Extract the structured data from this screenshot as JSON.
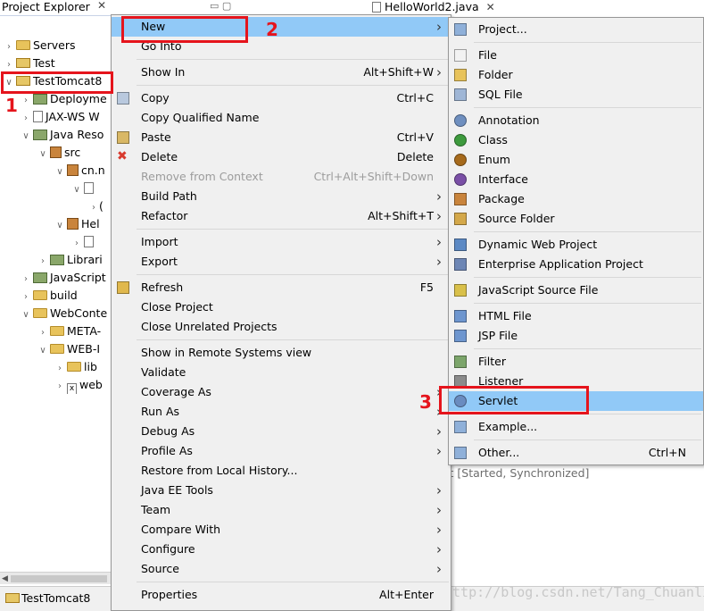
{
  "explorer": {
    "title": "Project Explorer",
    "close_glyph": "✕",
    "tree": [
      {
        "label": "Servers",
        "icon": "folder-icon",
        "depth": 1,
        "expanded": false
      },
      {
        "label": "Test",
        "icon": "project-icon",
        "depth": 1,
        "expanded": false
      },
      {
        "label": "TestTomcat8",
        "icon": "project-icon",
        "depth": 1,
        "expanded": true
      },
      {
        "label": "Deployme",
        "icon": "descriptor-icon",
        "depth": 2,
        "expanded": false
      },
      {
        "label": "JAX-WS W",
        "icon": "webservice-icon",
        "depth": 2,
        "expanded": false
      },
      {
        "label": "Java Reso",
        "icon": "java-resources-icon",
        "depth": 2,
        "expanded": true
      },
      {
        "label": "src",
        "icon": "source-folder-icon",
        "depth": 3,
        "expanded": true
      },
      {
        "label": "cn.n",
        "icon": "package-icon",
        "depth": 4,
        "expanded": true
      },
      {
        "label": "",
        "icon": "java-file-icon",
        "depth": 5,
        "expanded": true
      },
      {
        "label": "(",
        "icon": "",
        "depth": 6,
        "expanded": false
      },
      {
        "label": "Hel",
        "icon": "package-icon",
        "depth": 4,
        "expanded": true
      },
      {
        "label": "",
        "icon": "java-file-icon",
        "depth": 5,
        "expanded": false
      },
      {
        "label": "Librari",
        "icon": "library-icon",
        "depth": 3,
        "expanded": false
      },
      {
        "label": "JavaScript",
        "icon": "javascript-icon",
        "depth": 2,
        "expanded": false
      },
      {
        "label": "build",
        "icon": "folder-icon",
        "depth": 2,
        "expanded": false
      },
      {
        "label": "WebConte",
        "icon": "folder-icon",
        "depth": 2,
        "expanded": true
      },
      {
        "label": "META-",
        "icon": "folder-icon",
        "depth": 3,
        "expanded": false
      },
      {
        "label": "WEB-I",
        "icon": "folder-icon",
        "depth": 3,
        "expanded": true
      },
      {
        "label": "lib",
        "icon": "folder-icon",
        "depth": 4,
        "expanded": false
      },
      {
        "label": "web",
        "icon": "xml-file-icon",
        "depth": 4,
        "expanded": false
      }
    ]
  },
  "status_bar": {
    "text": "TestTomcat8"
  },
  "editor": {
    "tab_label": "HelloWorld2.java",
    "tab_close": "✕",
    "min_max": "▭ ▢",
    "server_status": "st  [Started, Synchronized]"
  },
  "context_menu": {
    "items": [
      {
        "label": "New",
        "shortcut": "",
        "submenu": true,
        "icon": "",
        "highlight": true
      },
      {
        "label": "Go Into",
        "shortcut": "",
        "submenu": false,
        "icon": ""
      },
      {
        "sep": true
      },
      {
        "label": "Show In",
        "shortcut": "Alt+Shift+W",
        "submenu": true,
        "icon": ""
      },
      {
        "sep": true
      },
      {
        "label": "Copy",
        "shortcut": "Ctrl+C",
        "submenu": false,
        "icon": "copy-icon"
      },
      {
        "label": "Copy Qualified Name",
        "shortcut": "",
        "submenu": false,
        "icon": ""
      },
      {
        "label": "Paste",
        "shortcut": "Ctrl+V",
        "submenu": false,
        "icon": "paste-icon"
      },
      {
        "label": "Delete",
        "shortcut": "Delete",
        "submenu": false,
        "icon": "delete-icon"
      },
      {
        "label": "Remove from Context",
        "shortcut": "Ctrl+Alt+Shift+Down",
        "submenu": false,
        "icon": "",
        "disabled": true
      },
      {
        "label": "Build Path",
        "shortcut": "",
        "submenu": true,
        "icon": ""
      },
      {
        "label": "Refactor",
        "shortcut": "Alt+Shift+T",
        "submenu": true,
        "icon": ""
      },
      {
        "sep": true
      },
      {
        "label": "Import",
        "shortcut": "",
        "submenu": true,
        "icon": ""
      },
      {
        "label": "Export",
        "shortcut": "",
        "submenu": true,
        "icon": ""
      },
      {
        "sep": true
      },
      {
        "label": "Refresh",
        "shortcut": "F5",
        "submenu": false,
        "icon": "refresh-icon"
      },
      {
        "label": "Close Project",
        "shortcut": "",
        "submenu": false,
        "icon": ""
      },
      {
        "label": "Close Unrelated Projects",
        "shortcut": "",
        "submenu": false,
        "icon": ""
      },
      {
        "sep": true
      },
      {
        "label": "Show in Remote Systems view",
        "shortcut": "",
        "submenu": false,
        "icon": ""
      },
      {
        "label": "Validate",
        "shortcut": "",
        "submenu": false,
        "icon": ""
      },
      {
        "label": "Coverage As",
        "shortcut": "",
        "submenu": true,
        "icon": ""
      },
      {
        "label": "Run As",
        "shortcut": "",
        "submenu": true,
        "icon": ""
      },
      {
        "label": "Debug As",
        "shortcut": "",
        "submenu": true,
        "icon": ""
      },
      {
        "label": "Profile As",
        "shortcut": "",
        "submenu": true,
        "icon": ""
      },
      {
        "label": "Restore from Local History...",
        "shortcut": "",
        "submenu": false,
        "icon": ""
      },
      {
        "label": "Java EE Tools",
        "shortcut": "",
        "submenu": true,
        "icon": ""
      },
      {
        "label": "Team",
        "shortcut": "",
        "submenu": true,
        "icon": ""
      },
      {
        "label": "Compare With",
        "shortcut": "",
        "submenu": true,
        "icon": ""
      },
      {
        "label": "Configure",
        "shortcut": "",
        "submenu": true,
        "icon": ""
      },
      {
        "label": "Source",
        "shortcut": "",
        "submenu": true,
        "icon": ""
      },
      {
        "sep": true
      },
      {
        "label": "Properties",
        "shortcut": "Alt+Enter",
        "submenu": false,
        "icon": ""
      }
    ]
  },
  "new_submenu": {
    "items": [
      {
        "label": "Project...",
        "shortcut": "",
        "icon": "new-project-icon"
      },
      {
        "sep": true
      },
      {
        "label": "File",
        "shortcut": "",
        "icon": "new-file-icon"
      },
      {
        "label": "Folder",
        "shortcut": "",
        "icon": "new-folder-icon"
      },
      {
        "label": "SQL File",
        "shortcut": "",
        "icon": "sql-file-icon"
      },
      {
        "sep": true
      },
      {
        "label": "Annotation",
        "shortcut": "",
        "icon": "annotation-icon"
      },
      {
        "label": "Class",
        "shortcut": "",
        "icon": "class-icon"
      },
      {
        "label": "Enum",
        "shortcut": "",
        "icon": "enum-icon"
      },
      {
        "label": "Interface",
        "shortcut": "",
        "icon": "interface-icon"
      },
      {
        "label": "Package",
        "shortcut": "",
        "icon": "package-icon"
      },
      {
        "label": "Source Folder",
        "shortcut": "",
        "icon": "source-folder-icon"
      },
      {
        "sep": true
      },
      {
        "label": "Dynamic Web Project",
        "shortcut": "",
        "icon": "web-project-icon"
      },
      {
        "label": "Enterprise Application Project",
        "shortcut": "",
        "icon": "ear-project-icon"
      },
      {
        "sep": true
      },
      {
        "label": "JavaScript Source File",
        "shortcut": "",
        "icon": "javascript-file-icon"
      },
      {
        "sep": true
      },
      {
        "label": "HTML File",
        "shortcut": "",
        "icon": "html-file-icon"
      },
      {
        "label": "JSP File",
        "shortcut": "",
        "icon": "jsp-file-icon"
      },
      {
        "sep": true
      },
      {
        "label": "Filter",
        "shortcut": "",
        "icon": "filter-icon"
      },
      {
        "label": "Listener",
        "shortcut": "",
        "icon": "listener-icon"
      },
      {
        "label": "Servlet",
        "shortcut": "",
        "icon": "servlet-icon",
        "highlight": true
      },
      {
        "sep": true
      },
      {
        "label": "Example...",
        "shortcut": "",
        "icon": "example-icon"
      },
      {
        "sep": true
      },
      {
        "label": "Other...",
        "shortcut": "Ctrl+N",
        "icon": "other-icon"
      }
    ]
  },
  "annotations": [
    {
      "number": "1"
    },
    {
      "number": "2"
    },
    {
      "number": "3"
    }
  ],
  "watermark": "http://blog.csdn.net/Tang_Chuanlin",
  "colors": {
    "highlight": "#91c9f7",
    "annotation": "#e5141c",
    "menu_bg": "#f0f0f0"
  }
}
